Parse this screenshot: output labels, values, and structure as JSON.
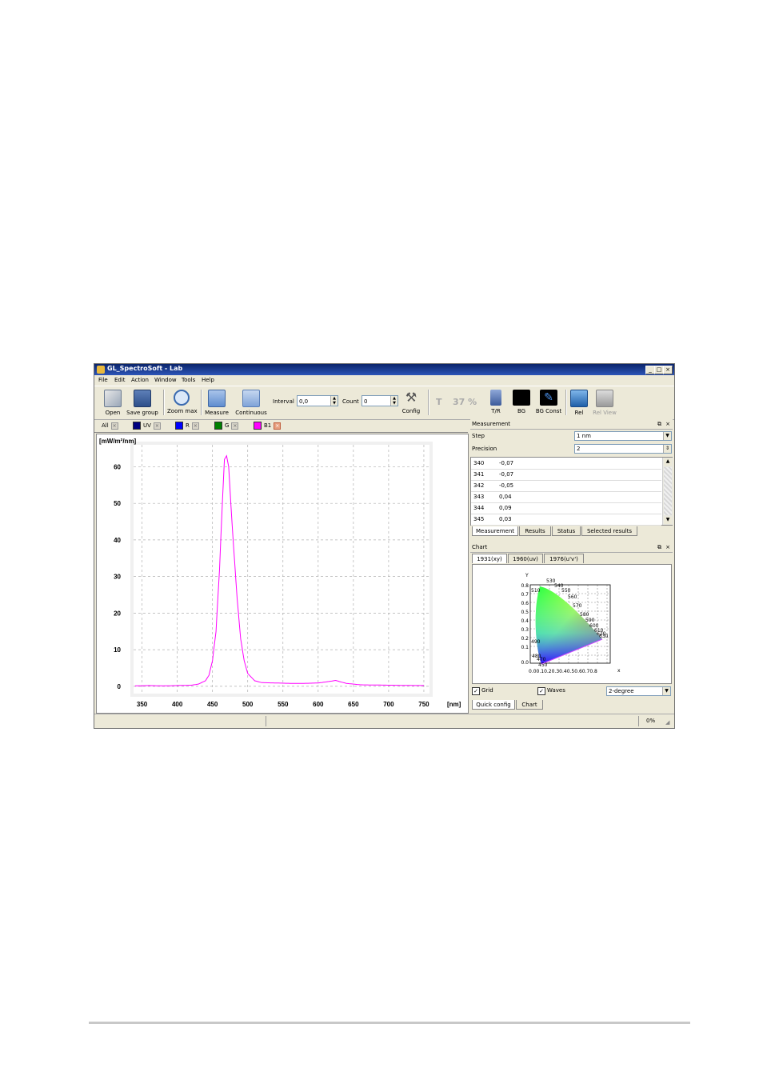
{
  "window": {
    "title": "GL_SpectroSoft - Lab",
    "controls": [
      "_",
      "□",
      "×"
    ]
  },
  "menu": [
    "File",
    "Edit",
    "Action",
    "Window",
    "Tools",
    "Help"
  ],
  "toolbar": {
    "open": "Open",
    "save_group": "Save group",
    "zoom_max": "Zoom max",
    "measure": "Measure",
    "continuous": "Continuous",
    "interval_label": "Interval",
    "interval_value": "0,0",
    "count_label": "Count",
    "count_value": "0",
    "config": "Config",
    "t_label": "T",
    "t_percent": "37 %",
    "tr": "T/R",
    "bg": "BG",
    "bg_const": "BG Const",
    "rel": "Rel",
    "rel_view": "Rel View"
  },
  "filters": [
    {
      "label": "All",
      "color": ""
    },
    {
      "label": "UV",
      "color": "#000080"
    },
    {
      "label": "R",
      "color": "#0000ff"
    },
    {
      "label": "G",
      "color": "#008000"
    },
    {
      "label": "B1",
      "color": "#ff00ff"
    }
  ],
  "chart_data": {
    "type": "line",
    "ylabel": "[mW/m²/nm]",
    "xlabel": "[nm]",
    "xlim": [
      338,
      758
    ],
    "ylim": [
      -2,
      66
    ],
    "xticks": [
      350,
      400,
      450,
      500,
      550,
      600,
      650,
      700,
      750
    ],
    "yticks": [
      0,
      10,
      20,
      30,
      40,
      50,
      60
    ],
    "grid": true,
    "series": [
      {
        "name": "B1",
        "color": "#ff00ff",
        "x": [
          340,
          360,
          380,
          400,
          420,
          430,
          440,
          445,
          450,
          455,
          460,
          464,
          467,
          470,
          473,
          476,
          480,
          485,
          490,
          495,
          500,
          510,
          520,
          540,
          560,
          580,
          600,
          615,
          625,
          630,
          640,
          660,
          700,
          740,
          750
        ],
        "y": [
          0.1,
          0.2,
          0.1,
          0.2,
          0.3,
          0.6,
          1.5,
          3,
          7,
          15,
          32,
          50,
          62,
          63,
          60,
          50,
          38,
          24,
          13,
          7,
          3.5,
          1.5,
          1.0,
          0.9,
          0.8,
          0.8,
          0.9,
          1.3,
          1.6,
          1.3,
          0.8,
          0.4,
          0.3,
          0.2,
          0.2
        ]
      }
    ]
  },
  "measurement_panel": {
    "title": "Measurement",
    "step_label": "Step",
    "step_value": "1 nm",
    "precision_label": "Precision",
    "precision_value": "2",
    "rows": [
      {
        "nm": "340",
        "value": "-0,07"
      },
      {
        "nm": "341",
        "value": "-0,07"
      },
      {
        "nm": "342",
        "value": "-0,05"
      },
      {
        "nm": "343",
        "value": "0,04"
      },
      {
        "nm": "344",
        "value": "0,09"
      },
      {
        "nm": "345",
        "value": "0,03"
      }
    ],
    "tabs": [
      "Measurement",
      "Results",
      "Status",
      "Selected results"
    ]
  },
  "chart_panel": {
    "title": "Chart",
    "tabs": [
      "1931(xy)",
      "1960(uv)",
      "1976(u'v')"
    ],
    "cie": {
      "y_axis": "Y",
      "x_axis": "x",
      "y_ticks": [
        "0.8",
        "0.7",
        "0.6",
        "0.5",
        "0.4",
        "0.3",
        "0.2",
        "0.1",
        "0.0"
      ],
      "x_ticks": "0.00.10.20.30.40.50.60.70.8",
      "wavelengths": [
        "530",
        "540",
        "510",
        "550",
        "560",
        "570",
        "580",
        "590",
        "600",
        "610",
        "620",
        "630",
        "490",
        "480",
        "470",
        "450"
      ]
    },
    "grid_label": "Grid",
    "grid_checked": true,
    "waves_label": "Waves",
    "waves_checked": true,
    "observer_value": "2-degree"
  },
  "bottom_tabs": [
    "Quick config",
    "Chart"
  ],
  "status": {
    "progress": "0%"
  }
}
